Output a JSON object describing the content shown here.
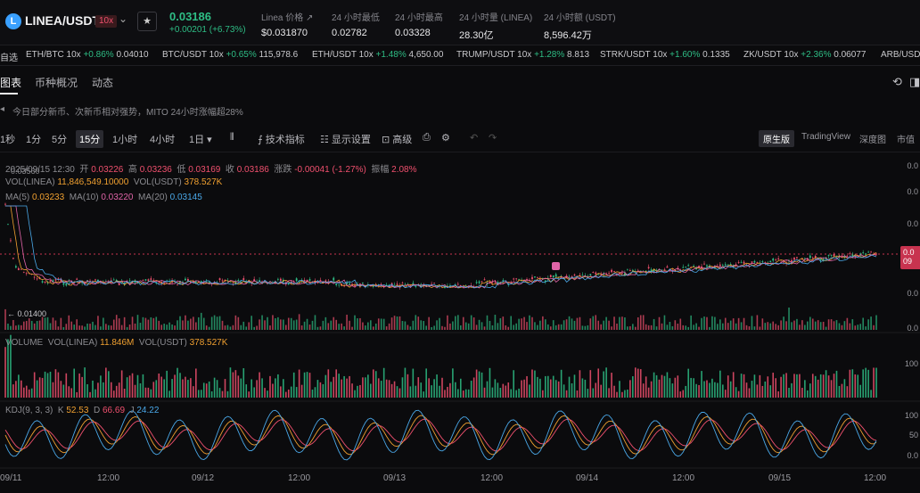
{
  "header": {
    "logo_letter": "L",
    "pair": "LINEA/USDT",
    "leverage": "10x",
    "price": "0.03186",
    "change": "+0.00201 (+6.73%)",
    "stats": [
      {
        "label": "Linea 价格 ↗",
        "value": "$0.031870"
      },
      {
        "label": "24 小时最低",
        "value": "0.02782"
      },
      {
        "label": "24 小时最高",
        "value": "0.03328"
      },
      {
        "label": "24 小时量 (LINEA)",
        "value": "28.30亿"
      },
      {
        "label": "24 小时额 (USDT)",
        "value": "8,596.42万"
      }
    ]
  },
  "ticker": [
    {
      "name": "自选",
      "chg": "",
      "price": ""
    },
    {
      "name": "ETH/BTC 10x",
      "chg": "+0.86%",
      "price": "0.04010"
    },
    {
      "name": "BTC/USDT 10x",
      "chg": "+0.65%",
      "price": "115,978.6"
    },
    {
      "name": "ETH/USDT 10x",
      "chg": "+1.48%",
      "price": "4,650.00"
    },
    {
      "name": "TRUMP/USDT 10x",
      "chg": "+1.28%",
      "price": "8.813"
    },
    {
      "name": "STRK/USDT 10x",
      "chg": "+1.60%",
      "price": "0.1335"
    },
    {
      "name": "ZK/USDT 10x",
      "chg": "+2.36%",
      "price": "0.06077"
    },
    {
      "name": "ARB/USDT",
      "chg": "",
      "price": ""
    }
  ],
  "tabs": [
    "图表",
    "币种概况",
    "动态"
  ],
  "notice": "今日部分新币、次新币相对强势，MITO 24小时涨幅超28%",
  "toolbar": {
    "intervals": [
      "1秒",
      "1分",
      "5分",
      "15分",
      "1小时",
      "4小时",
      "1日 ▾"
    ],
    "tools": [
      "技术指标",
      "显示设置",
      "高级"
    ],
    "views": [
      "原生版",
      "TradingView",
      "深度图",
      "市值"
    ]
  },
  "ohlc": {
    "date": "2025/09/15 12:30",
    "open_label": "开",
    "open": "0.03226",
    "high_label": "高",
    "high": "0.03236",
    "low_label": "低",
    "low": "0.03169",
    "close_label": "收",
    "close": "0.03186",
    "chg_label": "涨跌",
    "chg": "-0.00041 (-1.27%)",
    "amp_label": "振幅",
    "amp": "2.08%"
  },
  "vol_line": {
    "linea_label": "VOL(LINEA)",
    "linea": "11,846,549.10000",
    "usdt_label": "VOL(USDT)",
    "usdt": "378.527K"
  },
  "ma_line": {
    "ma5_label": "MA(5)",
    "ma5": "0.03233",
    "ma10_label": "MA(10)",
    "ma10": "0.03220",
    "ma20_label": "MA(20)",
    "ma20": "0.03145"
  },
  "price_labels": {
    "peak": "0.03560",
    "low": "← 0.01400"
  },
  "volume_pane": {
    "title": "VOLUME",
    "linea_label": "VOL(LINEA)",
    "linea": "11.846M",
    "usdt_label": "VOL(USDT)",
    "usdt": "378.527K"
  },
  "kdj": {
    "title": "KDJ(9, 3, 3)",
    "k_label": "K",
    "k": "52.53",
    "d_label": "D",
    "d": "66.69",
    "j_label": "J",
    "j": "24.22"
  },
  "right_axis": {
    "price": [
      "0.0",
      "0.0",
      "0.0",
      "0.0",
      "0.0",
      "0.0"
    ],
    "current_top": "0.0",
    "current_bottom": "09",
    "volume": [
      "100"
    ],
    "kdj": [
      "100",
      "50",
      "0.0"
    ]
  },
  "x_labels": [
    "09/11",
    "12:00",
    "09/12",
    "12:00",
    "09/13",
    "12:00",
    "09/14",
    "12:00",
    "09/15",
    "12:00"
  ],
  "colors": {
    "up": "#2ebd85",
    "down": "#f0506e",
    "ma5": "#f0a030",
    "ma10": "#e064a8",
    "ma20": "#4aa8e8"
  }
}
